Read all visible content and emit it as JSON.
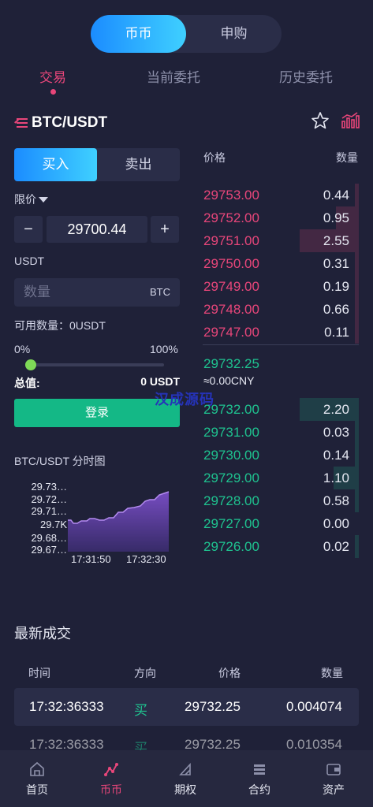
{
  "top_switch": {
    "active": "币币",
    "inactive": "申购"
  },
  "tabs": [
    "交易",
    "当前委托",
    "历史委托"
  ],
  "pair": {
    "title": "BTC/USDT"
  },
  "trade_form": {
    "buy_label": "买入",
    "sell_label": "卖出",
    "order_type": "限价",
    "price_value": "29700.44",
    "minus": "−",
    "plus": "+",
    "currency_label": "USDT",
    "qty_placeholder": "数量",
    "qty_unit": "BTC",
    "available": "可用数量：0USDT",
    "pct_min": "0%",
    "pct_max": "100%",
    "slider_level": 0,
    "total_label": "总值:",
    "total_value": "0 USDT",
    "login_label": "登录"
  },
  "watermark": "汉成源码",
  "mini_chart": {
    "title": "BTC/USDT 分时图",
    "y_ticks": [
      "29.73…",
      "29.72…",
      "29.71…",
      "29.7K",
      "29.68…",
      "29.67…"
    ],
    "x_ticks": [
      "17:31:50",
      "17:32:30"
    ],
    "line_color": "#9b6fe0"
  },
  "order_book": {
    "price_header": "价格",
    "qty_header": "数量",
    "asks": [
      {
        "price": "29753.00",
        "qty": "0.44",
        "depth": 0.06
      },
      {
        "price": "29752.00",
        "qty": "0.95",
        "depth": 0.38
      },
      {
        "price": "29751.00",
        "qty": "2.55",
        "depth": 1.0
      },
      {
        "price": "29750.00",
        "qty": "0.31",
        "depth": 0.06
      },
      {
        "price": "29749.00",
        "qty": "0.19",
        "depth": 0.06
      },
      {
        "price": "29748.00",
        "qty": "0.66",
        "depth": 0.06
      },
      {
        "price": "29747.00",
        "qty": "0.11",
        "depth": 0.06
      }
    ],
    "last_price": "29732.25",
    "cny": "≈0.00CNY",
    "bids": [
      {
        "price": "29732.00",
        "qty": "2.20",
        "depth": 1.0
      },
      {
        "price": "29731.00",
        "qty": "0.03",
        "depth": 0.06
      },
      {
        "price": "29730.00",
        "qty": "0.14",
        "depth": 0.06
      },
      {
        "price": "29729.00",
        "qty": "1.10",
        "depth": 0.43
      },
      {
        "price": "29728.00",
        "qty": "0.58",
        "depth": 0.06
      },
      {
        "price": "29727.00",
        "qty": "0.00",
        "depth": 0.0
      },
      {
        "price": "29726.00",
        "qty": "0.02",
        "depth": 0.06
      }
    ]
  },
  "trades": {
    "title": "最新成交",
    "headers": [
      "时间",
      "方向",
      "价格",
      "数量"
    ],
    "rows": [
      {
        "time": "17:32:36333",
        "dir": "买",
        "price": "29732.25",
        "qty": "0.004074"
      },
      {
        "time": "17:32:36333",
        "dir": "买",
        "price": "29732.25",
        "qty": "0.010354"
      }
    ]
  },
  "nav": [
    "首页",
    "币币",
    "期权",
    "合约",
    "资产"
  ],
  "colors": {
    "accent": "#e8467a",
    "up": "#1fc28f",
    "brand_blue": "#1b8cff"
  }
}
